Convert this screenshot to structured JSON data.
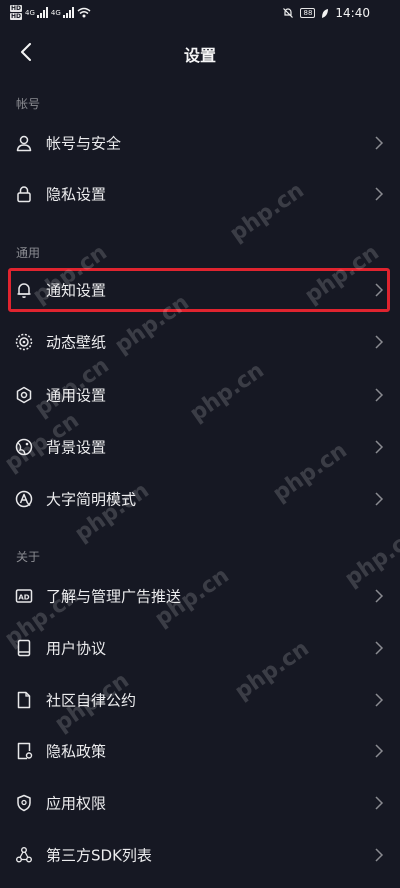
{
  "status_bar": {
    "hd1": "HD",
    "hd2": "HD",
    "net1": "4G",
    "net2": "4G",
    "battery": "88",
    "time": "14:40"
  },
  "header": {
    "title": "设置"
  },
  "sections": [
    {
      "title": "帐号",
      "items": [
        {
          "label": "帐号与安全",
          "icon": "user-icon"
        },
        {
          "label": "隐私设置",
          "icon": "lock-icon"
        }
      ]
    },
    {
      "title": "通用",
      "items": [
        {
          "label": "通知设置",
          "icon": "bell-icon",
          "highlighted": true
        },
        {
          "label": "动态壁纸",
          "icon": "wallpaper-icon"
        },
        {
          "label": "通用设置",
          "icon": "gear-icon"
        },
        {
          "label": "背景设置",
          "icon": "background-icon"
        },
        {
          "label": "大字简明模式",
          "icon": "large-text-icon"
        }
      ]
    },
    {
      "title": "关于",
      "items": [
        {
          "label": "了解与管理广告推送",
          "icon": "ad-icon"
        },
        {
          "label": "用户协议",
          "icon": "book-icon"
        },
        {
          "label": "社区自律公约",
          "icon": "document-icon"
        },
        {
          "label": "隐私政策",
          "icon": "privacy-doc-icon"
        },
        {
          "label": "应用权限",
          "icon": "shield-icon"
        },
        {
          "label": "第三方SDK列表",
          "icon": "share-icon"
        }
      ]
    }
  ],
  "watermark": "php.cn",
  "colors": {
    "background": "#161823",
    "highlight_border": "#e0242f"
  }
}
